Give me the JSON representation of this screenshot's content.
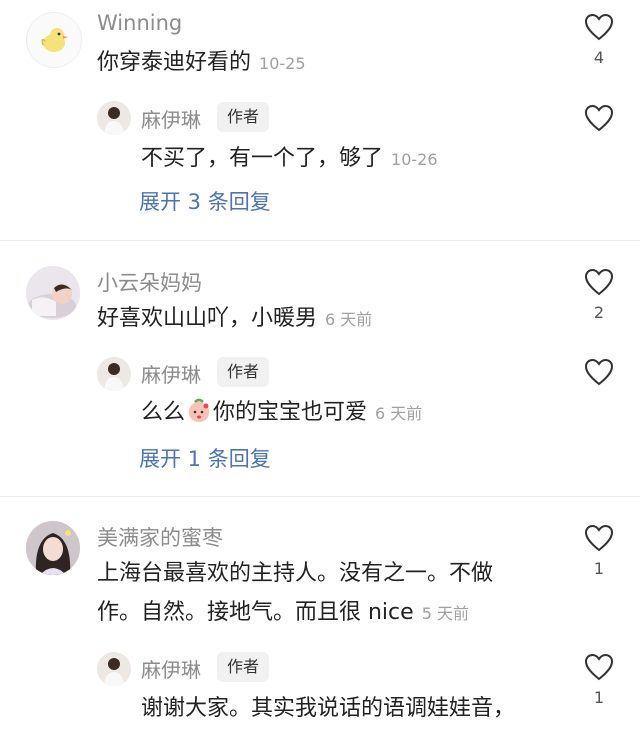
{
  "comments": [
    {
      "username": "Winning",
      "text": "你穿泰迪好看的",
      "time": "10-25",
      "likes": "4",
      "avatar_icon": "duck-sticker-icon",
      "replies": [
        {
          "username": "麻伊琳",
          "author_tag": "作者",
          "text": "不买了，有一个了，够了",
          "time": "10-26",
          "likes": ""
        }
      ],
      "expand_label": "展开 3 条回复"
    },
    {
      "username": "小云朵妈妈",
      "text": "好喜欢山山吖，小暖男",
      "time": "6 天前",
      "likes": "2",
      "avatar_icon": "sleeping-baby-photo",
      "replies": [
        {
          "username": "麻伊琳",
          "author_tag": "作者",
          "text_before": "么么",
          "emoji_icon": "peach-kiss-emoji-icon",
          "text_after": "你的宝宝也可爱",
          "time": "6 天前",
          "likes": ""
        }
      ],
      "expand_label": "展开 1 条回复"
    },
    {
      "username": "美满家的蜜枣",
      "text_line1": "上海台最喜欢的主持人。没有之一。不做",
      "text_line2": "作。自然。接地气。而且很 nice",
      "time": "5 天前",
      "likes": "1",
      "avatar_icon": "woman-portrait-photo",
      "replies": [
        {
          "username": "麻伊琳",
          "author_tag": "作者",
          "text": "谢谢大家。其实我说话的语调娃娃音，",
          "likes": "1"
        }
      ]
    }
  ],
  "colors": {
    "link": "#4a73b8",
    "meta": "#a0a0a0",
    "tag_bg": "#f1f1f1"
  }
}
